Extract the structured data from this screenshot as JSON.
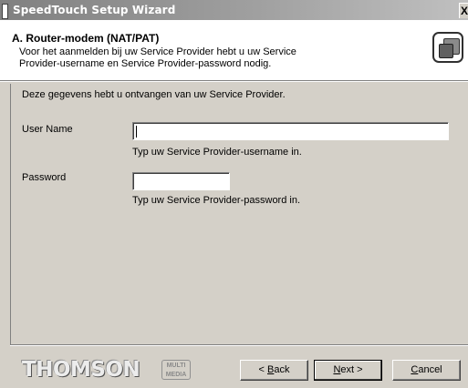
{
  "window": {
    "title": "SpeedTouch Setup Wizard",
    "close_glyph": "X"
  },
  "header": {
    "title": "A. Router-modem (NAT/PAT)",
    "description_line1": "Voor het aanmelden bij uw Service Provider hebt u uw Service",
    "description_line2": "Provider-username en Service Provider-password nodig.",
    "icon": "wizard-icon"
  },
  "body": {
    "intro": "Deze gegevens hebt u ontvangen van uw Service Provider.",
    "username": {
      "label": "User Name",
      "value": "",
      "hint": "Typ uw Service Provider-username in."
    },
    "password": {
      "label": "Password",
      "value": "",
      "hint": "Typ uw Service Provider-password in."
    }
  },
  "footer": {
    "logo_word": "THOMSON",
    "logo_tag_line1": "MULTI",
    "logo_tag_line2": "MEDIA",
    "back_mn": "B",
    "back_rest": "ack",
    "back_prefix": "< ",
    "next_mn": "N",
    "next_rest": "ext",
    "next_suffix": " >",
    "cancel_mn": "C",
    "cancel_rest": "ancel"
  }
}
